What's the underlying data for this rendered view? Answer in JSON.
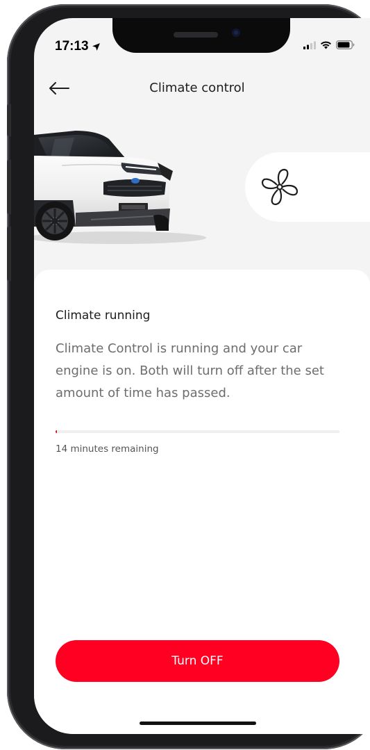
{
  "status_bar": {
    "time": "17:13"
  },
  "header": {
    "title": "Climate control"
  },
  "climate": {
    "heading": "Climate running",
    "description": "Climate Control is running and your car engine is on. Both will turn off after the set amount of time has passed.",
    "progress_fraction": 0.005,
    "remaining_text": "14 minutes remaining"
  },
  "actions": {
    "turn_off_label": "Turn OFF"
  },
  "colors": {
    "accent": "#ff0022",
    "progress": "#eb0a1e",
    "background": "#f4f4f4"
  },
  "icons": {
    "back": "arrow-left-icon",
    "fan": "fan-icon",
    "location": "location-arrow-icon",
    "signal": "cellular-signal-icon",
    "wifi": "wifi-icon",
    "battery": "battery-icon"
  }
}
